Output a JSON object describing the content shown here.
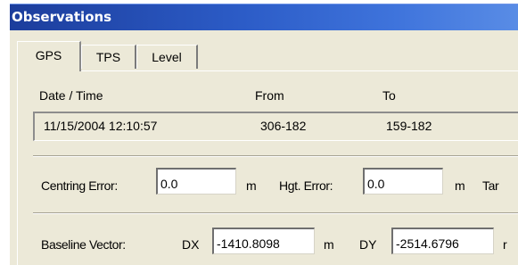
{
  "window": {
    "title": "Observations"
  },
  "tabs": [
    {
      "label": "GPS",
      "active": true
    },
    {
      "label": "TPS",
      "active": false
    },
    {
      "label": "Level",
      "active": false
    }
  ],
  "record": {
    "headers": {
      "datetime": "Date / Time",
      "from": "From",
      "to": "To"
    },
    "values": {
      "datetime": "11/15/2004 12:10:57",
      "from": "306-182",
      "to": "159-182"
    }
  },
  "errors": {
    "centring_label": "Centring Error:",
    "centring_value": "0.0",
    "centring_unit": "m",
    "height_label": "Hgt. Error:",
    "height_value": "0.0",
    "height_unit": "m",
    "next_label_partial": "Tar"
  },
  "baseline": {
    "label": "Baseline Vector:",
    "dx_label": "DX",
    "dx_value": "-1410.8098",
    "dx_unit": "m",
    "dy_label": "DY",
    "dy_value": "-2514.6796",
    "dy_unit_partial": "r"
  }
}
